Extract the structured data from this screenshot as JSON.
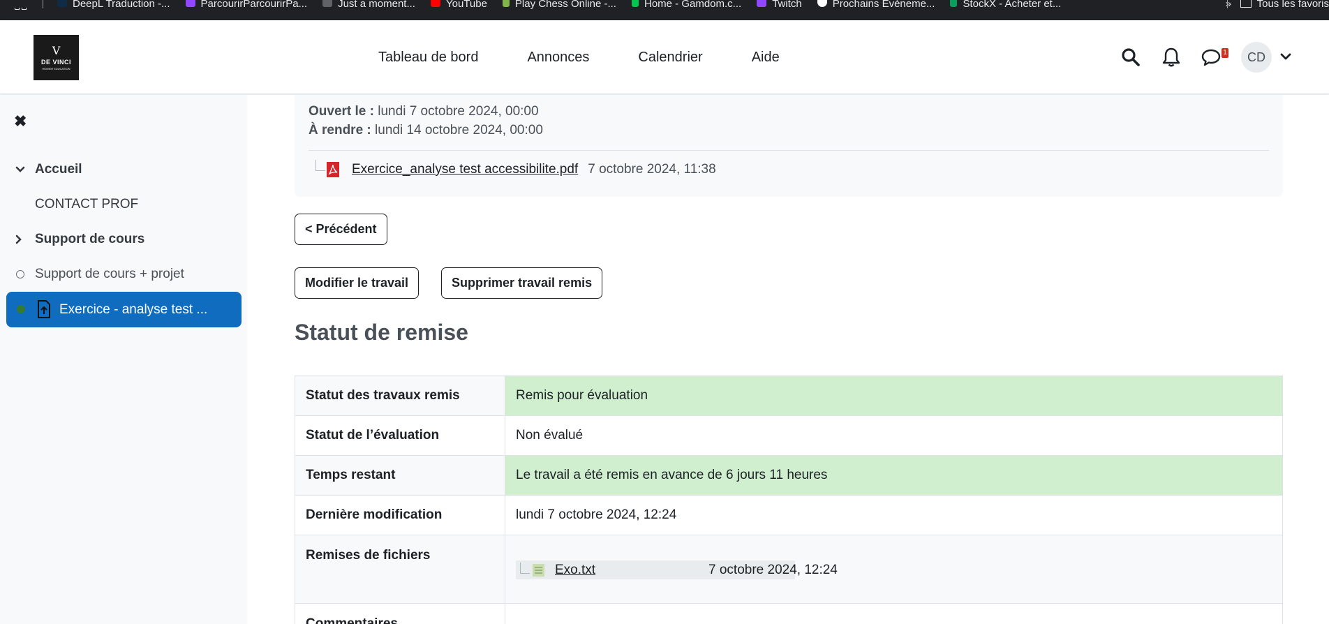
{
  "bookmarks": {
    "items": [
      {
        "label": "DeepL Traduction -...",
        "color": "#0f2b46"
      },
      {
        "label": "ParcourirParcourirPa...",
        "color": "#9146ff"
      },
      {
        "label": "Just a moment...",
        "color": "#5f6368"
      },
      {
        "label": "YouTube",
        "color": "#ff0000"
      },
      {
        "label": "Play Chess Online -...",
        "color": "#81b64c"
      },
      {
        "label": "Home - Gamdom.c...",
        "color": "#00c74d"
      },
      {
        "label": "Twitch",
        "color": "#9146ff"
      },
      {
        "label": "Prochains Événeme...",
        "color": "#ffffff"
      },
      {
        "label": "StockX - Acheter et...",
        "color": "#08a05c"
      }
    ],
    "more": "»",
    "folder": "Tous les favoris"
  },
  "header": {
    "logo": {
      "mark": "V",
      "name": "DE VINCI",
      "sub": "HIGHER EDUCATION"
    },
    "nav": [
      "Tableau de bord",
      "Annonces",
      "Calendrier",
      "Aide"
    ],
    "messages_badge": "1",
    "avatar_initials": "CD"
  },
  "drawer": {
    "close": "✖",
    "items": [
      {
        "label": "Accueil",
        "type": "section-open"
      },
      {
        "label": "CONTACT PROF",
        "type": "link"
      },
      {
        "label": "Support de cours",
        "type": "section-closed"
      },
      {
        "label": "Support de cours + projet",
        "type": "activity"
      }
    ],
    "active": "Exercice - analyse test ..."
  },
  "assignment": {
    "opened_label": "Ouvert le :",
    "opened_value": "lundi 7 octobre 2024, 00:00",
    "due_label": "À rendre :",
    "due_value": "lundi 14 octobre 2024, 00:00",
    "file_name": "Exercice_analyse test accessibilite.pdf",
    "file_date": "7 octobre 2024, 11:38"
  },
  "buttons": {
    "previous": "< Précédent",
    "edit": "Modifier le travail",
    "delete": "Supprimer travail remis"
  },
  "status": {
    "title": "Statut de remise",
    "rows": [
      {
        "label": "Statut des travaux remis",
        "value": "Remis pour évaluation"
      },
      {
        "label": "Statut de l’évaluation",
        "value": "Non évalué"
      },
      {
        "label": "Temps restant",
        "value": "Le travail a été remis en avance de 6 jours 11 heures"
      },
      {
        "label": "Dernière modification",
        "value": "lundi 7 octobre 2024, 12:24"
      },
      {
        "label": "Remises de fichiers",
        "file_name": "Exo.txt",
        "file_date": "7 octobre 2024, 12:24"
      },
      {
        "label": "Commentaires",
        "value": ""
      }
    ]
  },
  "colors": {
    "accent": "#0f6cbf",
    "success_bg": "#cfefcf"
  }
}
